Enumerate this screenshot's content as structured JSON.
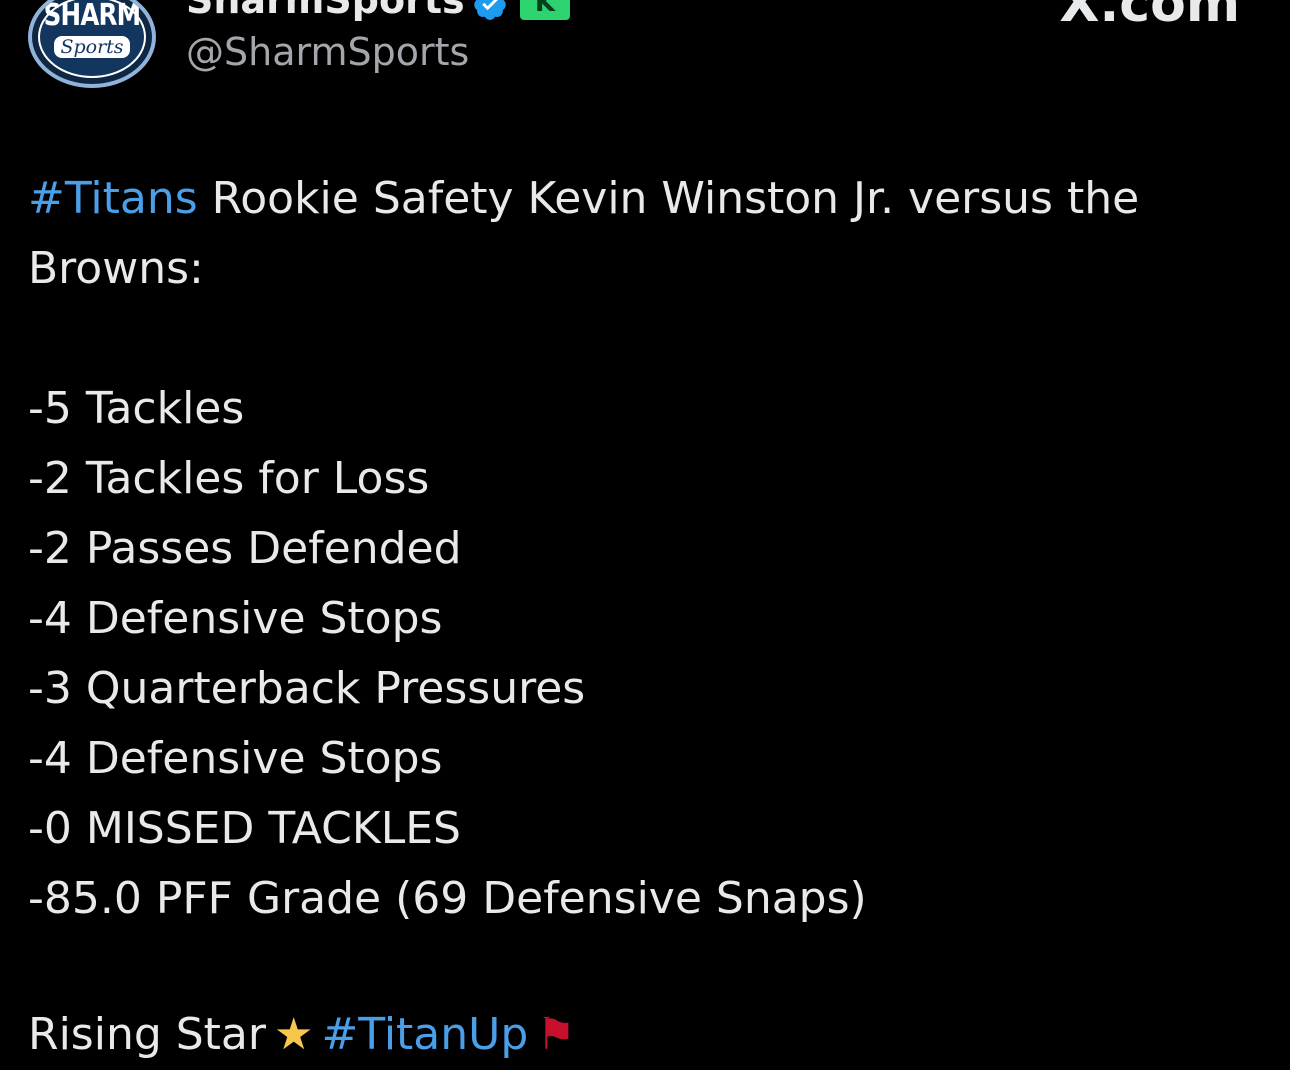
{
  "header": {
    "avatar_text_top": "SHARM",
    "avatar_text_bottom": "Sports",
    "display_name": "SharmSports",
    "handle": "@SharmSports",
    "badge_letter": "K",
    "watermark": "X.com"
  },
  "tweet": {
    "hashtag": "#Titans",
    "intro_rest": " Rookie Safety Kevin Winston Jr. versus the",
    "intro_line2": "Browns:",
    "stats": [
      "-5 Tackles",
      "-2 Tackles for Loss",
      "-2 Passes Defended",
      "-4 Defensive Stops",
      "-3 Quarterback Pressures",
      "-4 Defensive Stops",
      "-0 MISSED TACKLES",
      "-85.0 PFF Grade (69 Defensive Snaps)"
    ],
    "closing_text": "Rising Star",
    "closing_hashtag": "#TitanUp"
  },
  "icons": {
    "verified": "verified-badge-icon",
    "star": "star-icon",
    "flag": "flag-icon"
  },
  "colors": {
    "background": "#000000",
    "text": "#e7e9ea",
    "secondary_text": "#a3a7ab",
    "hashtag": "#4a9fe8",
    "verified": "#1d9bf0",
    "badge": "#2dd36f"
  }
}
